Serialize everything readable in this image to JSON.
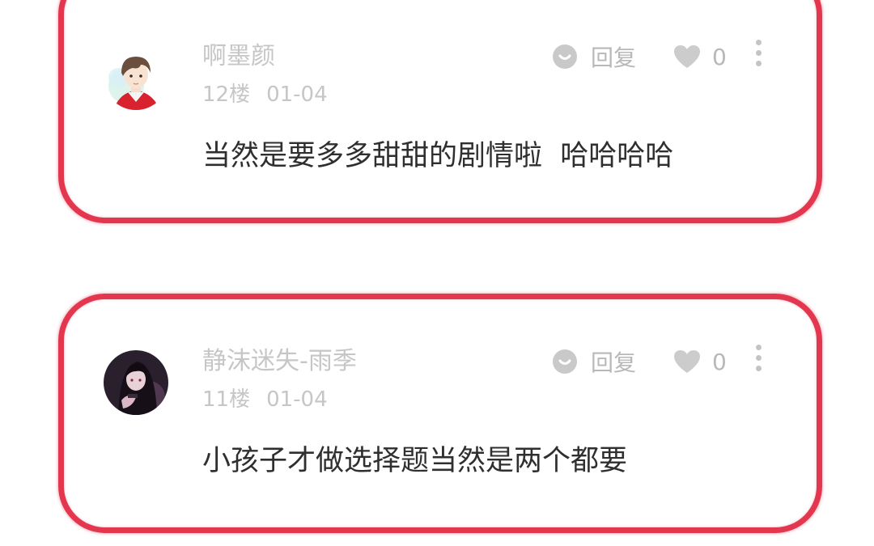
{
  "accent_color": "#e2374f",
  "comments": [
    {
      "username": "啊墨颜",
      "floor": "12楼",
      "date": "01-04",
      "reply_label": "回复",
      "like_count": "0",
      "text": "当然是要多多甜甜的剧情啦  哈哈哈哈",
      "avatar_icon": "avatar-anime-boy-icon"
    },
    {
      "username": "静沫迷失-雨季",
      "floor": "11楼",
      "date": "01-04",
      "reply_label": "回复",
      "like_count": "0",
      "text": "小孩子才做选择题当然是两个都要",
      "avatar_icon": "avatar-anime-girl-icon"
    }
  ]
}
